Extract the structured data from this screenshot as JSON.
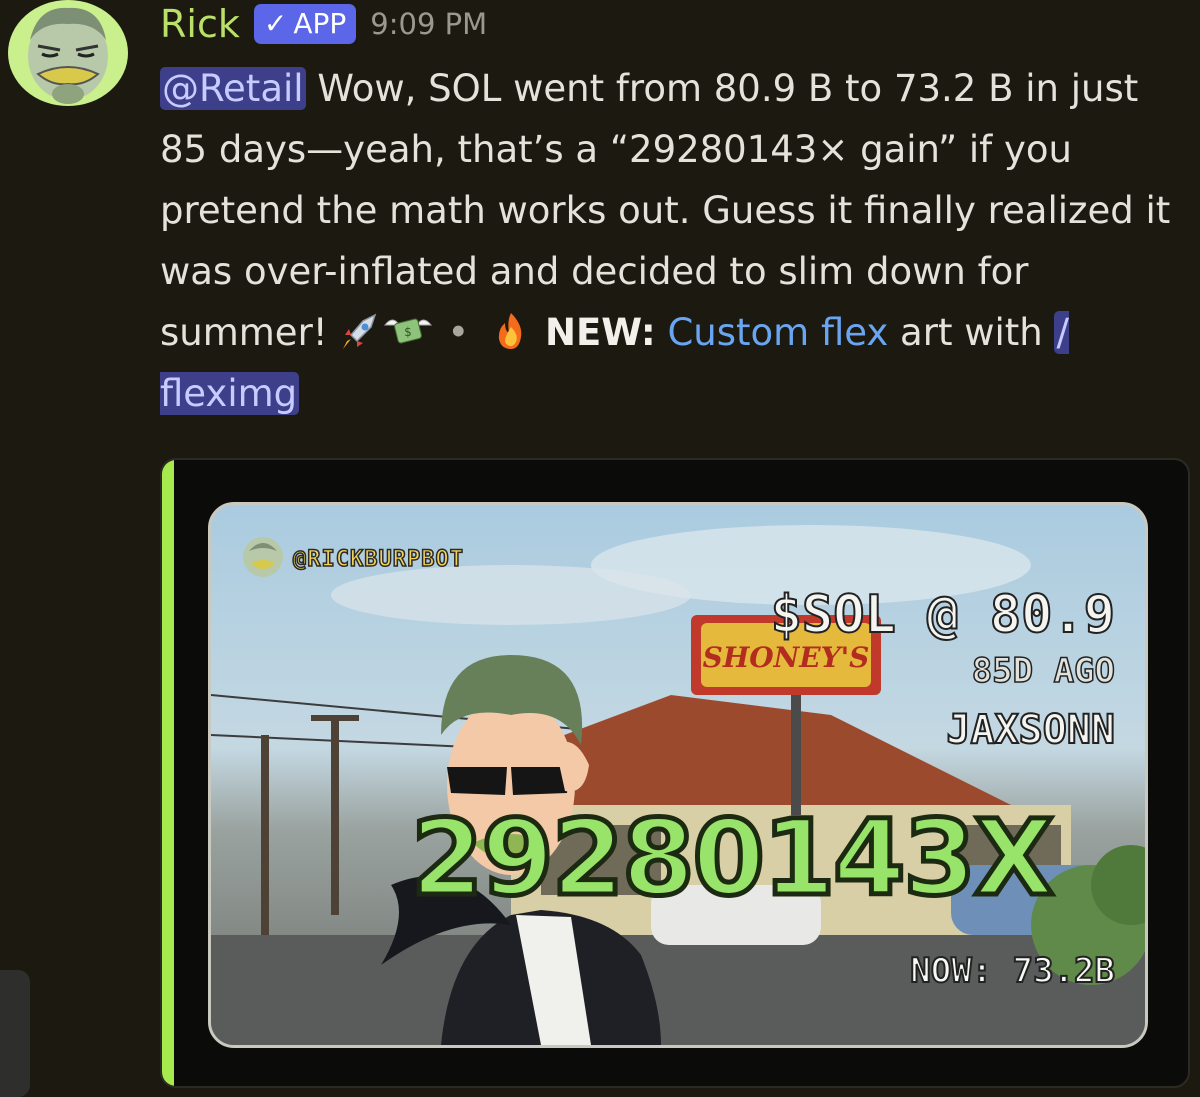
{
  "message": {
    "username": "Rick",
    "badge_label": "APP",
    "timestamp": "9:09 PM",
    "mention": "@Retail",
    "text_main": " Wow, SOL went from 80.9 B to 73.2 B in just 85 days—yeah, that’s a “29280143× gain” if you pretend the math works out. Guess it finally realized it was over-inflated and decided to slim down for summer! ",
    "separator": "•",
    "new_label": "NEW:",
    "link_text": "Custom flex",
    "text_tail": " art with ",
    "command": "/ fleximg"
  },
  "card": {
    "handle": "@RICKBURPBOT",
    "token_line": "$SOL @ 80.9",
    "ago_line": "85D AGO",
    "user_line": "JAXSONN",
    "gain_line": "29280143X",
    "now_line": "NOW: 73.2B",
    "sign_text": "SHONEY'S"
  },
  "icons": {
    "verified": "check-icon",
    "rocket": "rocket-emoji",
    "money": "money-wings-emoji",
    "fire": "fire-emoji"
  },
  "colors": {
    "username": "#b9e16a",
    "badge": "#5b66e8",
    "link": "#6aa5f2",
    "embed_bar": "#a6ea4e",
    "gain": "#98e36a"
  }
}
